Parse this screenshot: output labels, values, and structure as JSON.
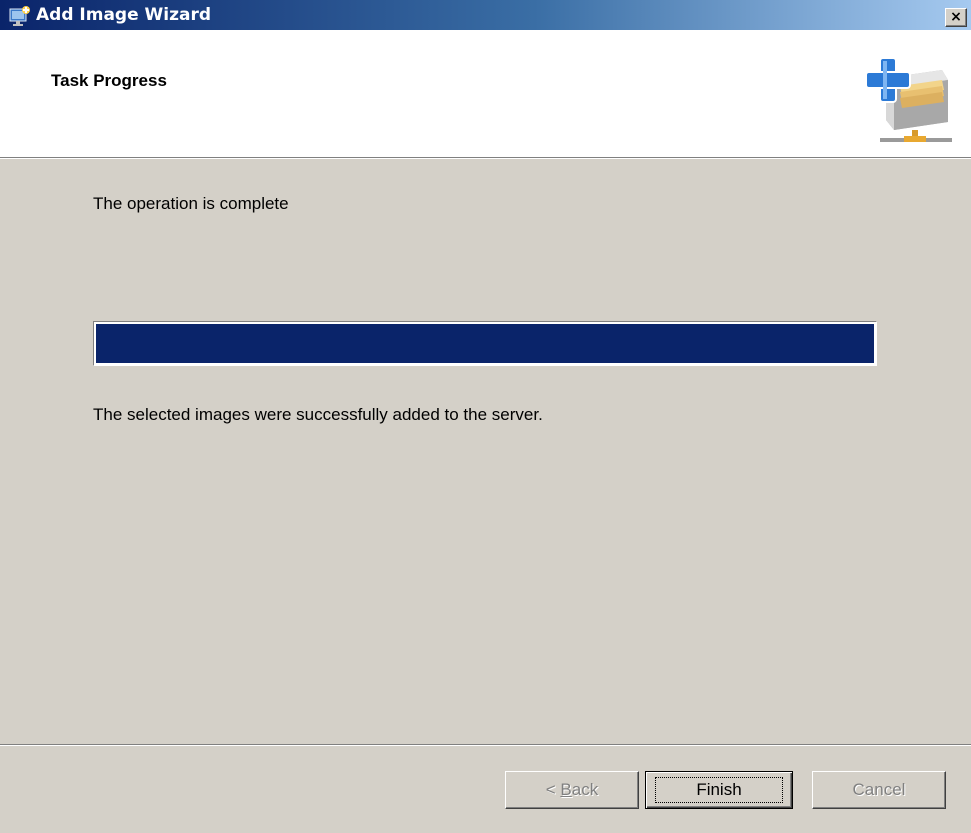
{
  "window": {
    "title": "Add Image Wizard",
    "close_symbol": "×"
  },
  "header": {
    "title": "Task Progress",
    "graphic_icon": "add-image-server-icon"
  },
  "content": {
    "status": "The operation is complete",
    "progress_fraction": 1.0,
    "progress_color": "#0a246a",
    "result": "The selected images were successfully added to the server."
  },
  "buttons": {
    "back": {
      "prefix": "< ",
      "mnemonic": "B",
      "rest": "ack",
      "enabled": false
    },
    "finish": {
      "label": "Finish",
      "enabled": true,
      "default": true
    },
    "cancel": {
      "label": "Cancel",
      "enabled": false
    }
  },
  "colors": {
    "titlebar_start": "#0a246a",
    "titlebar_end": "#a6caf0",
    "dialog_face": "#d4d0c8"
  }
}
